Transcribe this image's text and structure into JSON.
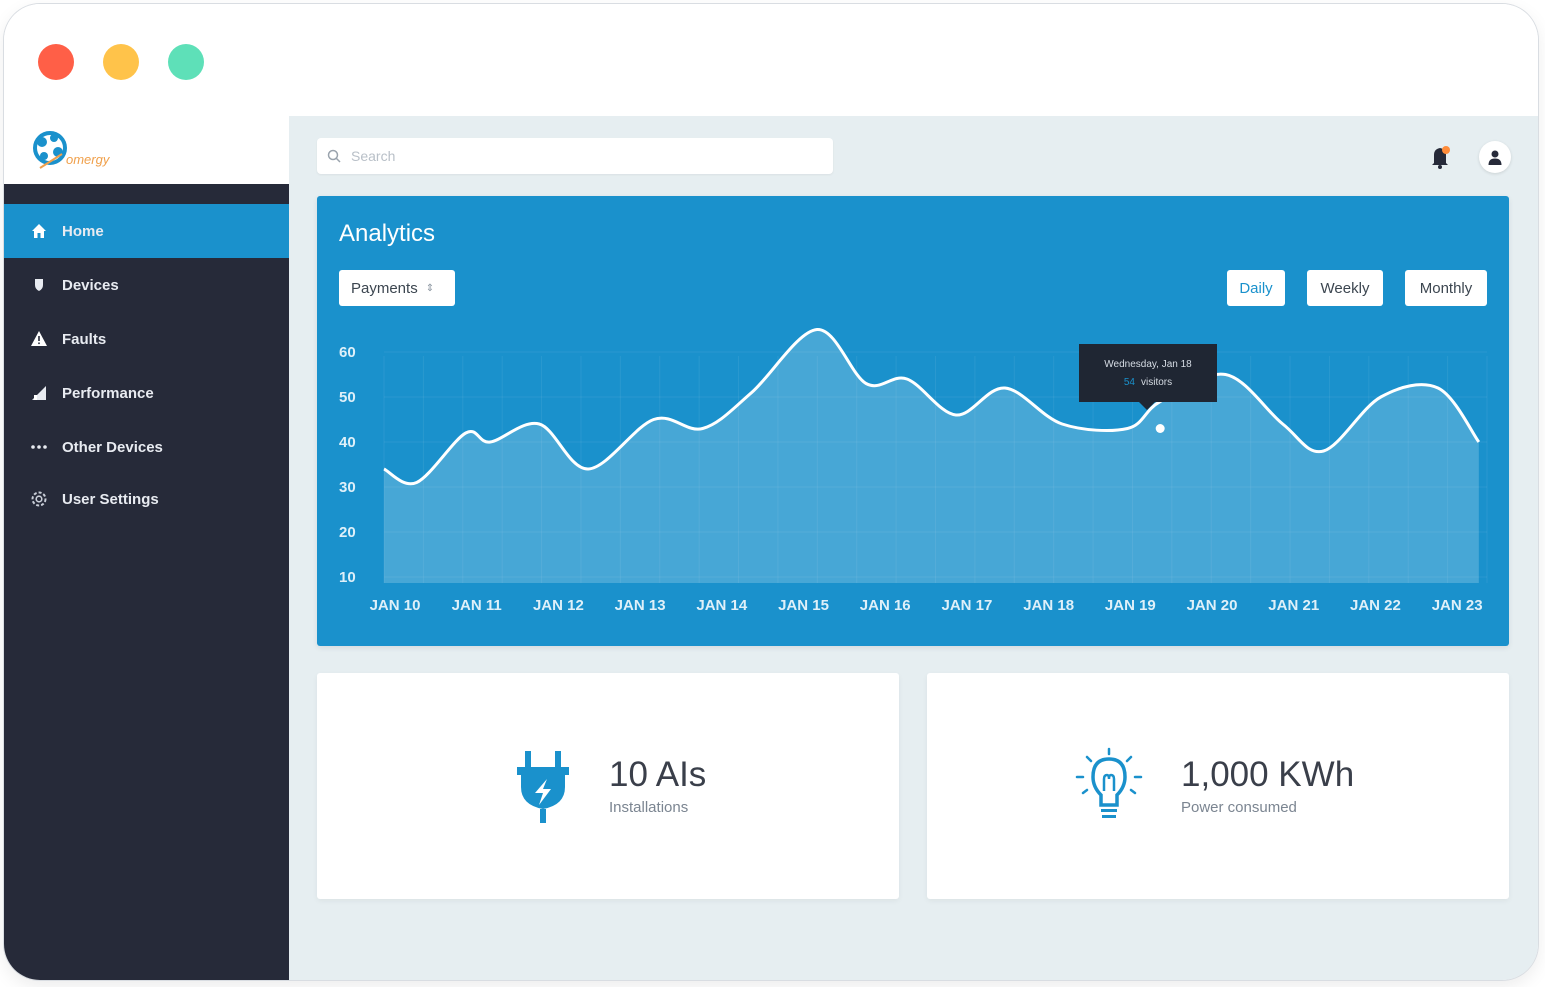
{
  "window": {
    "controls": [
      "close",
      "minimize",
      "maximize"
    ]
  },
  "brand": {
    "logo_text": "omergy"
  },
  "sidebar": {
    "items": [
      {
        "label": "Home",
        "icon": "home-icon",
        "active": true
      },
      {
        "label": "Devices",
        "icon": "device-icon",
        "active": false
      },
      {
        "label": "Faults",
        "icon": "warning-icon",
        "active": false
      },
      {
        "label": "Performance",
        "icon": "chart-icon",
        "active": false
      },
      {
        "label": "Other Devices",
        "icon": "dots-icon",
        "active": false
      },
      {
        "label": "User Settings",
        "icon": "settings-icon",
        "active": false
      }
    ]
  },
  "header": {
    "search_placeholder": "Search",
    "icons": [
      "notification-bell-icon",
      "user-avatar-icon"
    ]
  },
  "analytics": {
    "title": "Analytics",
    "metric_select": "Payments",
    "ranges": [
      "Daily",
      "Weekly",
      "Monthly"
    ],
    "selected_range": "Daily",
    "tooltip": {
      "date": "Wednesday, Jan 18",
      "value": "54",
      "unit": "visitors"
    }
  },
  "chart_data": {
    "type": "area",
    "x": [
      "JAN 10",
      "JAN 11",
      "JAN 12",
      "JAN 13",
      "JAN 14",
      "JAN 15",
      "JAN 16",
      "JAN 17",
      "JAN 18",
      "JAN 19",
      "JAN 20",
      "JAN 21",
      "JAN 22",
      "JAN 23"
    ],
    "y_ticks": [
      60,
      50,
      40,
      30,
      20,
      10
    ],
    "ylim": [
      10,
      60
    ],
    "series": [
      {
        "x": [
          10.0,
          10.4,
          11.0,
          11.3,
          11.9,
          12.5,
          13.3,
          13.9,
          14.5,
          15.3,
          15.9,
          16.4,
          17.0,
          17.6,
          18.3,
          19.1,
          19.5,
          20.3,
          21.0,
          21.5,
          22.2,
          22.9,
          23.4
        ],
        "y": [
          34,
          31,
          42,
          40,
          44,
          34,
          45,
          43,
          51,
          65,
          53,
          54,
          46,
          52,
          44,
          43,
          49,
          55,
          44,
          38,
          50,
          52,
          40
        ]
      }
    ],
    "grid": true,
    "area_fill": true,
    "line_color": "#ffffff",
    "highlight_point": {
      "x": 19.5,
      "y": 43
    }
  },
  "stats": [
    {
      "value": "10 AIs",
      "label": "Installations",
      "icon": "plug-icon"
    },
    {
      "value": "1,000 KWh",
      "label": "Power consumed",
      "icon": "lightbulb-icon"
    }
  ],
  "colors": {
    "accent": "#1a91cc",
    "sidebar_bg": "#262a39",
    "main_bg": "#e6eef1",
    "close": "#ff5f47",
    "minimize": "#ffc34a",
    "maximize": "#5ee0b8"
  }
}
